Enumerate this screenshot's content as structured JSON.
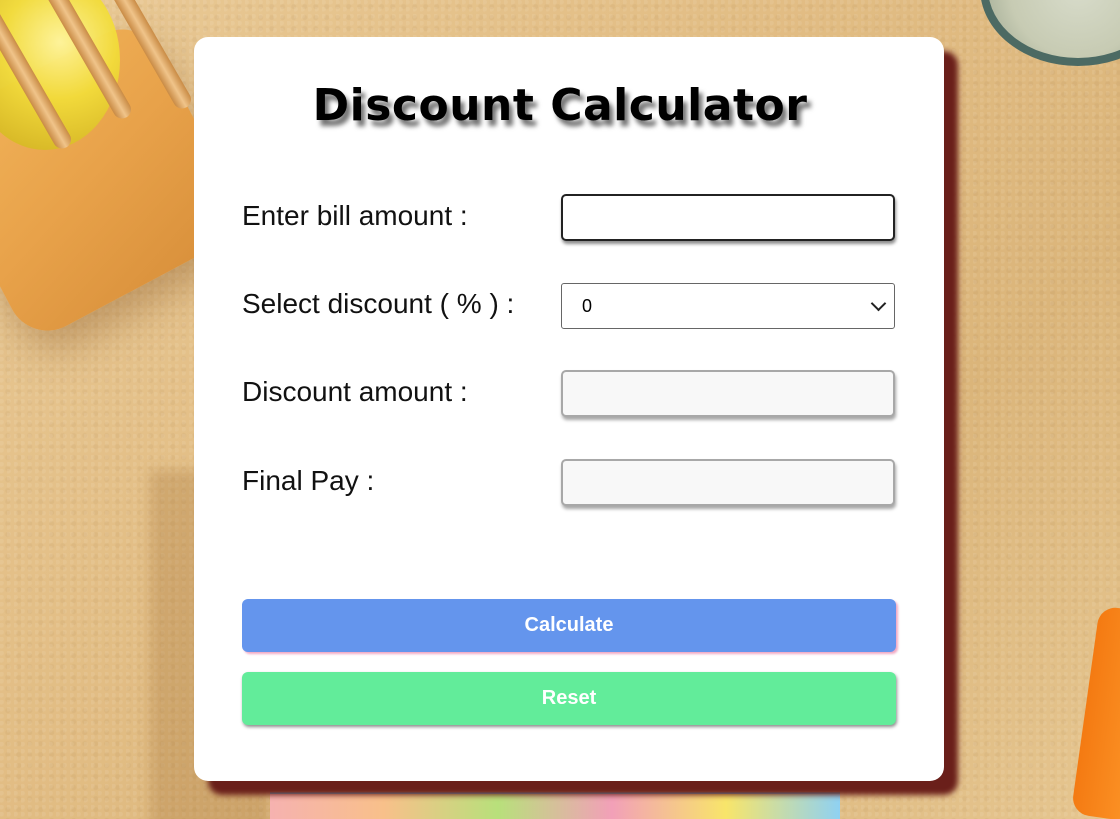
{
  "app": {
    "title": "Discount Calculator"
  },
  "form": {
    "bill_label": "Enter bill amount :",
    "bill_value": "",
    "discount_label": "Select discount ( % ) :",
    "discount_selected": "0",
    "discount_amount_label": "Discount amount :",
    "discount_amount_value": "",
    "final_pay_label": "Final Pay :",
    "final_pay_value": ""
  },
  "buttons": {
    "calculate_label": "Calculate",
    "reset_label": "Reset"
  },
  "colors": {
    "calculate_bg": "#6495ed",
    "reset_bg": "#62ec9a",
    "card_shadow": "#6a1f1a"
  },
  "icons": {
    "select_indicator": "chevron-down-icon"
  }
}
